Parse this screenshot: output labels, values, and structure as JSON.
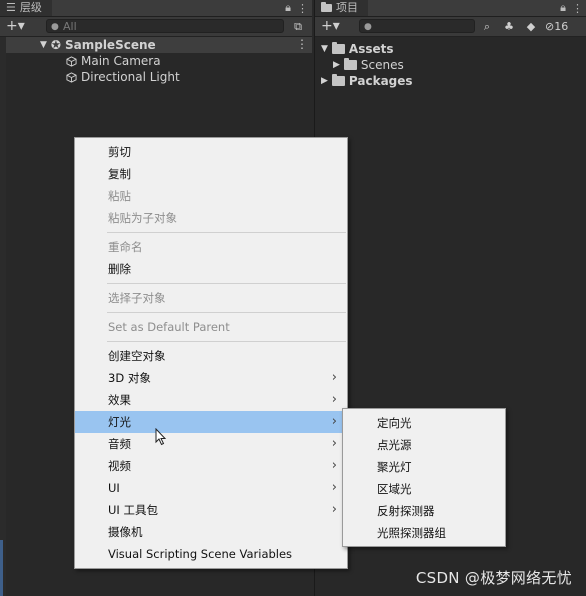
{
  "hierarchy": {
    "tab_title": "层级",
    "search_placeholder": "All",
    "scene_name": "SampleScene",
    "items": [
      "Main Camera",
      "Directional Light"
    ]
  },
  "project": {
    "tab_title": "项目",
    "hidden_count": "16",
    "tree": [
      {
        "label": "Assets"
      },
      {
        "label": "Scenes"
      },
      {
        "label": "Packages"
      }
    ]
  },
  "context_menu": {
    "items": [
      {
        "label": "剪切"
      },
      {
        "label": "复制"
      },
      {
        "label": "粘贴"
      },
      {
        "label": "粘贴为子对象"
      },
      {
        "label": "重命名"
      },
      {
        "label": "删除"
      },
      {
        "label": "选择子对象"
      },
      {
        "label": "Set as Default Parent"
      },
      {
        "label": "创建空对象"
      },
      {
        "label": "3D 对象"
      },
      {
        "label": "效果"
      },
      {
        "label": "灯光"
      },
      {
        "label": "音频"
      },
      {
        "label": "视频"
      },
      {
        "label": "UI"
      },
      {
        "label": "UI 工具包"
      },
      {
        "label": "摄像机"
      },
      {
        "label": "Visual Scripting Scene Variables"
      }
    ]
  },
  "submenu": {
    "items": [
      {
        "label": "定向光"
      },
      {
        "label": "点光源"
      },
      {
        "label": "聚光灯"
      },
      {
        "label": "区域光"
      },
      {
        "label": "反射探测器"
      },
      {
        "label": "光照探测器组"
      }
    ]
  },
  "watermark": "CSDN @极梦网络无忧",
  "colors": {
    "highlight": "#99c4f0",
    "menu_bg": "#f0f0f0",
    "panel_bg": "#282828"
  }
}
